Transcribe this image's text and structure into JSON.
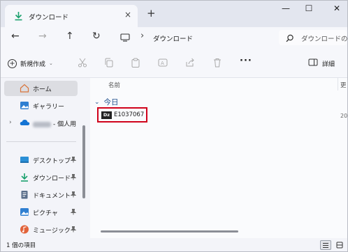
{
  "window": {
    "tab_title": "ダウンロード",
    "tab_close": "×",
    "new_tab": "+",
    "controls": {
      "minimize": "—",
      "maximize": "☐",
      "close": "✕"
    }
  },
  "nav": {
    "back": "←",
    "forward": "→",
    "up": "↑",
    "refresh": "↻",
    "breadcrumb_separator": "›",
    "path": "ダウンロード",
    "search_placeholder": "ダウンロードの検索"
  },
  "command_bar": {
    "new_label": "新規作成",
    "new_caret": "⌄",
    "more": "···",
    "details_label": "詳細"
  },
  "sidebar": {
    "expander": "›",
    "items": [
      {
        "label": "ホーム",
        "icon": "home-icon",
        "selected": true
      },
      {
        "label": "ギャラリー",
        "icon": "gallery-icon"
      },
      {
        "label": "- 個人用",
        "icon": "onedrive-icon"
      },
      {
        "label": "デスクトップ",
        "icon": "desktop-icon",
        "pinned": true
      },
      {
        "label": "ダウンロード",
        "icon": "download-icon",
        "pinned": true
      },
      {
        "label": "ドキュメント",
        "icon": "documents-icon",
        "pinned": true
      },
      {
        "label": "ピクチャ",
        "icon": "pictures-icon",
        "pinned": true
      },
      {
        "label": "ミュージック",
        "icon": "music-icon",
        "pinned": true
      }
    ]
  },
  "content": {
    "columns": {
      "name": "名前",
      "modified": "更"
    },
    "group_chevron": "⌄",
    "group_label": "今日",
    "file": {
      "icon_text": "Dz",
      "name": "E1037067",
      "date": "20"
    }
  },
  "status": {
    "item_count": "1 個の項目"
  },
  "colors": {
    "accent": "#1e4e8c",
    "highlight_border": "#d0021b",
    "download_green": "#1aa06d"
  }
}
